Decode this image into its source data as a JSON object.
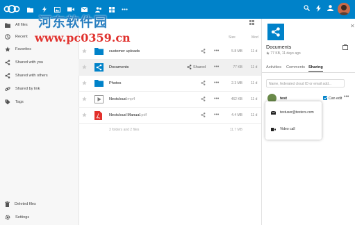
{
  "watermark": {
    "line1": "河东软件园",
    "line2": "www.pc0359.cn"
  },
  "header": {
    "accent_color": "#0082c9",
    "apps": [
      "files-icon",
      "activity-icon",
      "gallery-icon",
      "video-icon",
      "mail-icon",
      "contacts-icon",
      "more-apps-icon"
    ],
    "right_icons": [
      "search-icon",
      "notifications-icon",
      "contacts-menu-icon"
    ]
  },
  "sidebar": {
    "items": [
      {
        "label": "All files",
        "icon": "folder-icon"
      },
      {
        "label": "Recent",
        "icon": "clock-icon"
      },
      {
        "label": "Favorites",
        "icon": "star-icon"
      },
      {
        "label": "Shared with you",
        "icon": "share-icon"
      },
      {
        "label": "Shared with others",
        "icon": "share-icon"
      },
      {
        "label": "Shared by link",
        "icon": "link-icon"
      },
      {
        "label": "Tags",
        "icon": "tag-icon"
      }
    ],
    "deleted": "Deleted files",
    "settings": "Settings"
  },
  "files": {
    "columns": {
      "size": "Size",
      "modified": "Mod"
    },
    "rows": [
      {
        "name": "customer uploads",
        "ext": "",
        "type": "folder",
        "shared_label": "",
        "size": "5.8 MB",
        "modified": "11 d"
      },
      {
        "name": "Documents",
        "ext": "",
        "type": "shared-folder",
        "shared_label": "Shared",
        "size": "77 KB",
        "modified": "11 d"
      },
      {
        "name": "Photos",
        "ext": "",
        "type": "folder",
        "shared_label": "",
        "size": "2.3 MB",
        "modified": "11 d"
      },
      {
        "name": "Nextcloud",
        "ext": ".mp4",
        "type": "video",
        "shared_label": "",
        "size": "462 KB",
        "modified": "11 d"
      },
      {
        "name": "Nextcloud Manual",
        "ext": ".pdf",
        "type": "pdf",
        "shared_label": "",
        "size": "4.4 MB",
        "modified": "11 d"
      }
    ],
    "summary": "3 folders and 2 files",
    "summary_size": "11.7 MB"
  },
  "details": {
    "title": "Documents",
    "meta": "77 KB, 11 days ago",
    "tabs": [
      "Activities",
      "Comments",
      "Sharing"
    ],
    "active_tab": "Sharing",
    "search_placeholder": "Name, federated cloud ID or email add...",
    "share_user": "test",
    "can_edit_label": "Can edit",
    "can_edit_checked": true
  },
  "popup": {
    "items": [
      {
        "label": "testuser@testers.com",
        "icon": "email-icon"
      },
      {
        "label": "Video call",
        "icon": "video-icon"
      }
    ]
  }
}
